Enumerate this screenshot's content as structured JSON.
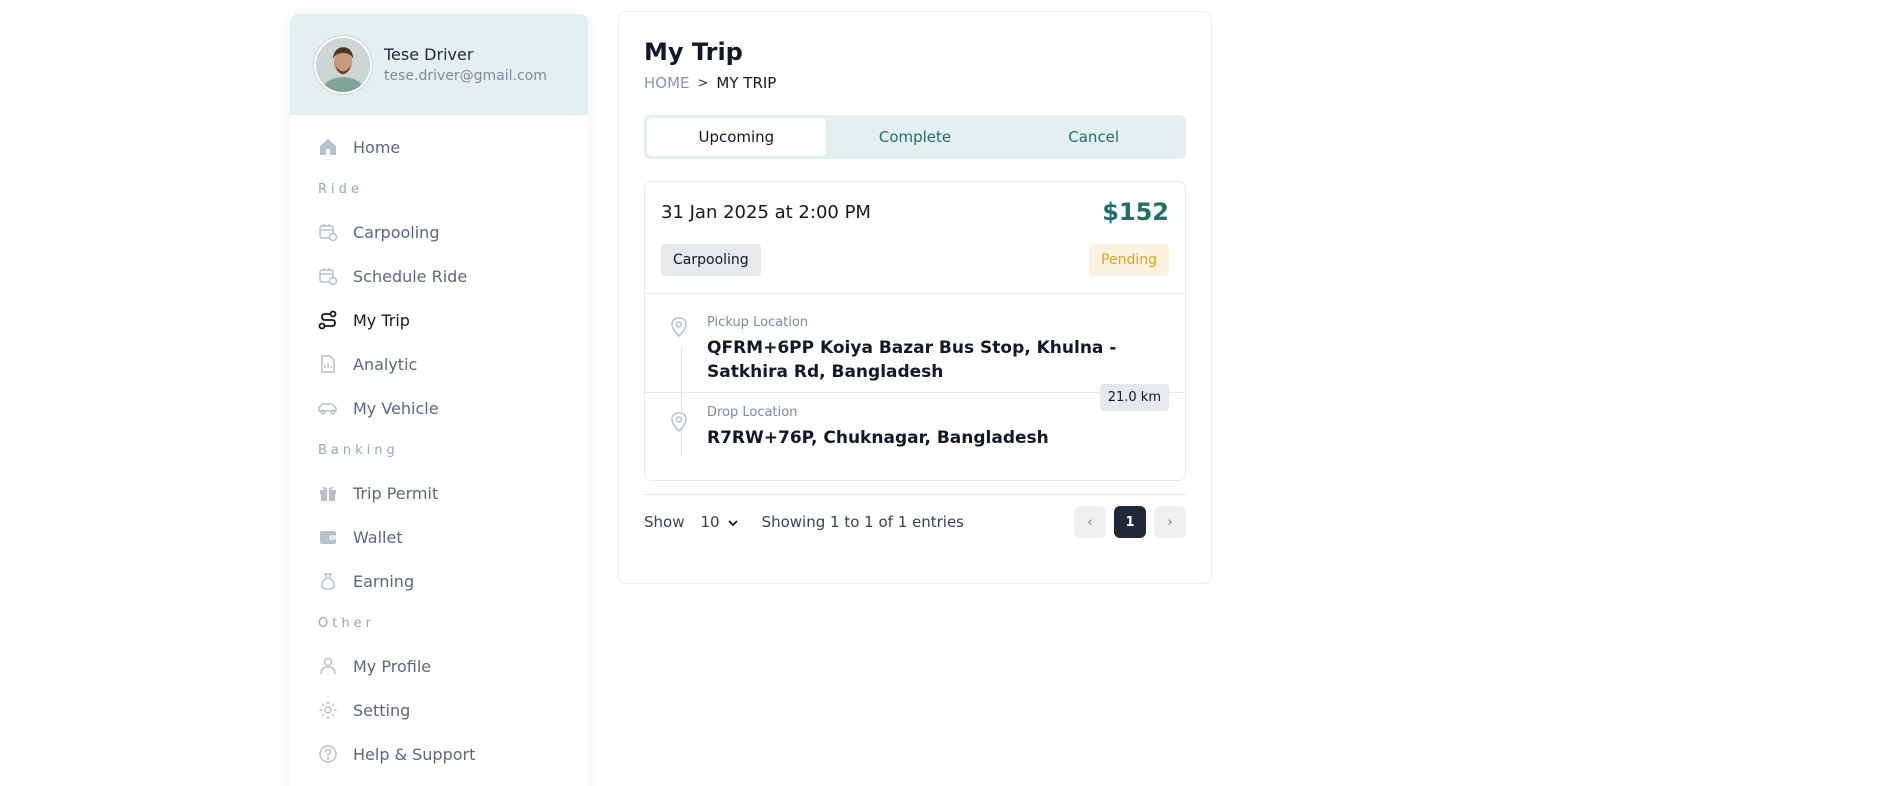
{
  "profile": {
    "name": "Tese Driver",
    "email": "tese.driver@gmail.com"
  },
  "sidebar": {
    "home": "Home",
    "section_ride": "Ride",
    "carpooling": "Carpooling",
    "schedule_ride": "Schedule Ride",
    "my_trip": "My Trip",
    "analytic": "Analytic",
    "my_vehicle": "My Vehicle",
    "section_banking": "Banking",
    "trip_permit": "Trip Permit",
    "wallet": "Wallet",
    "earning": "Earning",
    "section_other": "Other",
    "my_profile": "My Profile",
    "setting": "Setting",
    "help_support": "Help & Support"
  },
  "page": {
    "title": "My Trip",
    "breadcrumb_home": "HOME",
    "breadcrumb_sep": ">",
    "breadcrumb_current": "MY TRIP"
  },
  "tabs": {
    "upcoming": "Upcoming",
    "complete": "Complete",
    "cancel": "Cancel"
  },
  "trip": {
    "datetime": "31 Jan 2025 at 2:00 PM",
    "price": "$152",
    "type": "Carpooling",
    "status": "Pending",
    "pickup_label": "Pickup Location",
    "pickup_value": "QFRM+6PP Koiya Bazar Bus Stop, Khulna - Satkhira Rd, Bangladesh",
    "drop_label": "Drop Location",
    "drop_value": "R7RW+76P, Chuknagar, Bangladesh",
    "distance": "21.0 km"
  },
  "footer": {
    "show_label": "Show",
    "page_size": "10",
    "entries_text": "Showing 1 to 1 of 1 entries",
    "prev": "‹",
    "current_page": "1",
    "next": "›"
  },
  "colors": {
    "accent": "#1f6f6d",
    "profile_bg": "#e4eff0",
    "pending": "#e5a21a"
  }
}
